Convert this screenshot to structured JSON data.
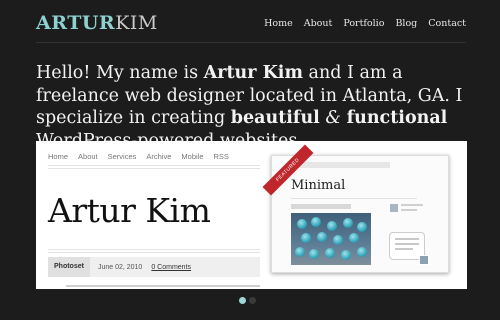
{
  "header": {
    "logo_first": "ARTUR",
    "logo_second": "KIM",
    "nav": [
      "Home",
      "About",
      "Portfolio",
      "Blog",
      "Contact"
    ]
  },
  "intro": {
    "p1": "Hello! My name is ",
    "name": "Artur Kim",
    "p2": " and I am a freelance web designer located in Atlanta, GA. I specialize in creating ",
    "strong1": "beautiful",
    "amp": "&",
    "strong2": "functional",
    "p3": " WordPress-powered websites"
  },
  "showcase": {
    "mini_nav": [
      "Home",
      "About",
      "Services",
      "Archive",
      "Mobile",
      "RSS"
    ],
    "site_title": "Artur Kim",
    "meta_tag": "Photoset",
    "meta_date": "June 02, 2010",
    "meta_comments": "0 Comments",
    "thumb_ribbon": "FEATURED",
    "thumb_title": "Minimal"
  },
  "pager": {
    "active_index": 0,
    "count": 2
  },
  "colors": {
    "accent": "#8fd1d1",
    "background": "#1c1c1c",
    "ribbon": "#c0272d"
  }
}
